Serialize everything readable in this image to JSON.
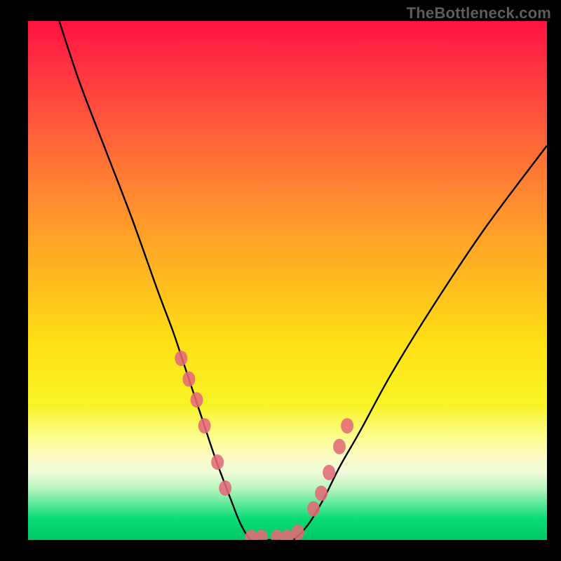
{
  "watermark": "TheBottleneck.com",
  "chart_data": {
    "type": "line",
    "title": "",
    "xlabel": "",
    "ylabel": "",
    "xlim": [
      0,
      100
    ],
    "ylim": [
      0,
      100
    ],
    "series": [
      {
        "name": "bottleneck-curve",
        "x": [
          6,
          10,
          15,
          20,
          25,
          28,
          30,
          33,
          36,
          39,
          41,
          43,
          45,
          48,
          51,
          54,
          57,
          60,
          64,
          70,
          78,
          88,
          100
        ],
        "y": [
          100,
          88,
          75,
          62,
          48,
          40,
          34,
          25,
          16,
          8,
          3,
          0,
          0,
          0,
          0,
          3,
          8,
          14,
          21,
          32,
          45,
          60,
          76
        ]
      }
    ],
    "markers": {
      "name": "sample-points",
      "color": "#e46a78",
      "x": [
        29.5,
        31,
        32.5,
        34,
        36.5,
        38,
        43,
        45,
        48,
        50,
        52,
        55,
        56.5,
        58,
        60,
        61.5
      ],
      "y": [
        35,
        31,
        27,
        22,
        15,
        10,
        0.5,
        0.5,
        0.5,
        0.5,
        1.5,
        6,
        9,
        13,
        18,
        22
      ]
    },
    "background": {
      "type": "vertical-gradient",
      "stops": [
        {
          "pos": 0,
          "color": "#ff1240"
        },
        {
          "pos": 50,
          "color": "#ffd018"
        },
        {
          "pos": 80,
          "color": "#fdfd8c"
        },
        {
          "pos": 100,
          "color": "#00c766"
        }
      ]
    }
  }
}
